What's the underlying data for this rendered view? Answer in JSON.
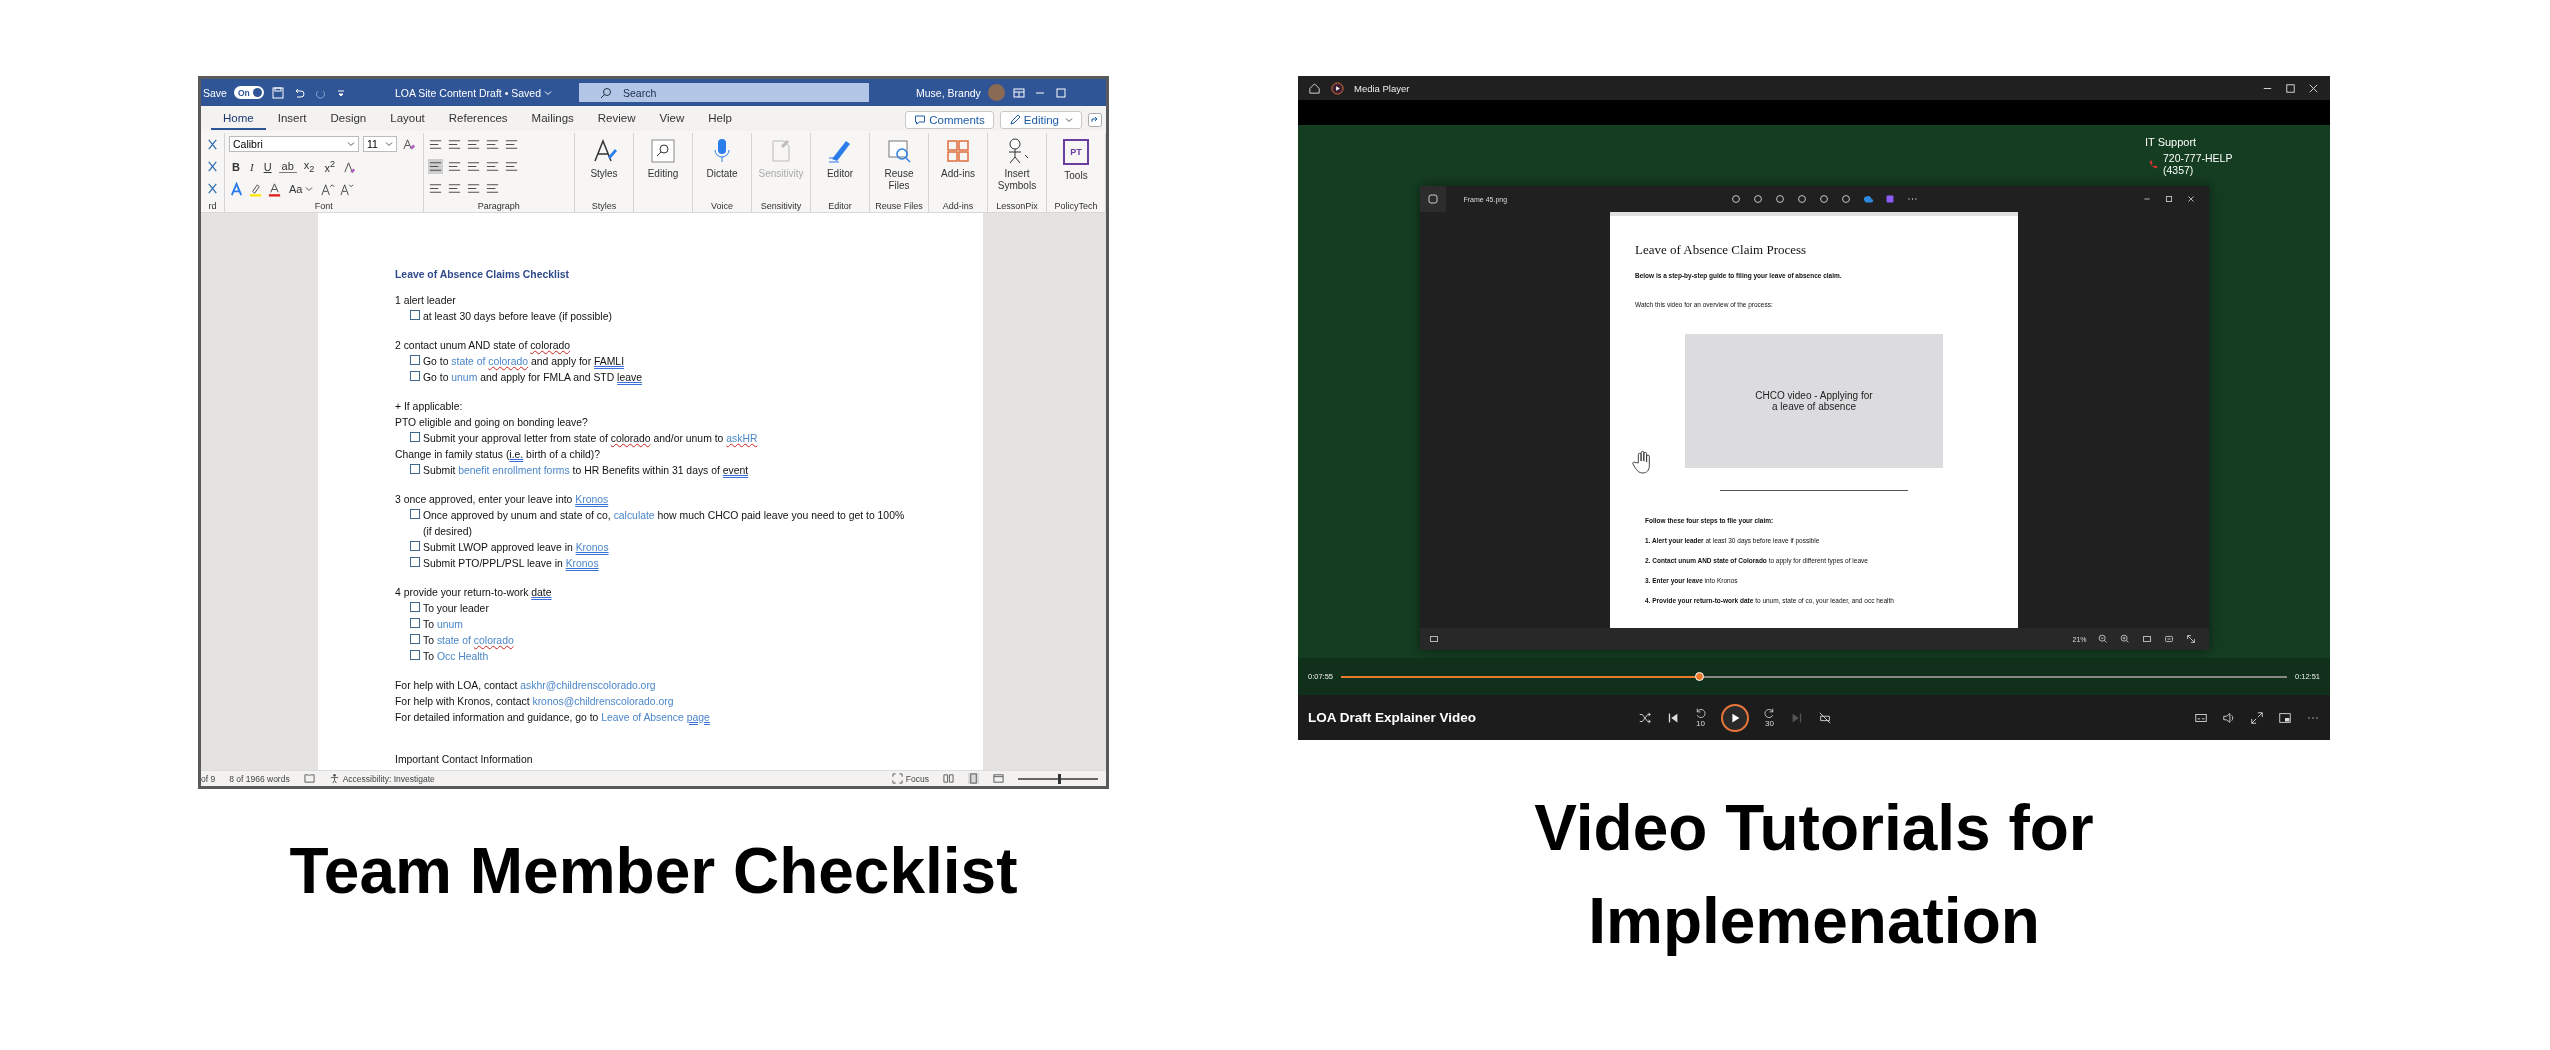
{
  "word": {
    "title_bar": {
      "save_label": "Save",
      "autosave": {
        "label": "On",
        "on": true
      },
      "doc_title": "LOA Site Content Draft • Saved",
      "search_placeholder": "Search",
      "user": "Muse, Brandy"
    },
    "tabs": [
      {
        "label": "Home",
        "selected": true
      },
      {
        "label": "Insert",
        "selected": false
      },
      {
        "label": "Design",
        "selected": false
      },
      {
        "label": "Layout",
        "selected": false
      },
      {
        "label": "References",
        "selected": false
      },
      {
        "label": "Mailings",
        "selected": false
      },
      {
        "label": "Review",
        "selected": false
      },
      {
        "label": "View",
        "selected": false
      },
      {
        "label": "Help",
        "selected": false
      }
    ],
    "comments_button": "Comments",
    "editing_button": "Editing",
    "ribbon": {
      "clipboard_label": "rd",
      "font_label": "Font",
      "font_name": "Calibri",
      "font_size": "11",
      "format_buttons": [
        "B",
        "I",
        "U",
        "ab",
        "x$_{2}$",
        "x$^{2}$"
      ],
      "case_button": "Aa",
      "paragraph_label": "Paragraph",
      "groups": [
        {
          "label": "Styles",
          "buttons": [
            {
              "label": "Styles",
              "disabled": false
            }
          ]
        },
        {
          "buttons": [
            {
              "label": "Editing",
              "disabled": false
            }
          ]
        },
        {
          "label": "Voice",
          "buttons": [
            {
              "label": "Dictate",
              "disabled": false
            }
          ]
        },
        {
          "label": "Sensitivity",
          "buttons": [
            {
              "label": "Sensitivity",
              "disabled": true
            }
          ]
        },
        {
          "label": "Editor",
          "buttons": [
            {
              "label": "Editor",
              "disabled": false
            }
          ]
        },
        {
          "label": "Reuse Files",
          "buttons": [
            {
              "label": "Reuse Files",
              "disabled": false
            }
          ]
        },
        {
          "label": "Add-ins",
          "buttons": [
            {
              "label": "Add-ins",
              "disabled": false
            }
          ]
        },
        {
          "label": "LessonPix",
          "buttons": [
            {
              "label": "Insert Symbols",
              "disabled": false
            }
          ]
        },
        {
          "label": "PolicyTech",
          "buttons": [
            {
              "label": "Tools",
              "disabled": false
            }
          ]
        }
      ],
      "tools_badge": "PT"
    },
    "document": [
      {
        "kind": "heading",
        "segments": [
          {
            "text": "Leave of Absence Claims Checklist",
            "link": false
          }
        ]
      },
      {
        "kind": "text",
        "segments": [
          {
            "text": "1 alert leader",
            "link": false
          }
        ]
      },
      {
        "kind": "check",
        "checked": false,
        "segments": [
          {
            "text": "at least 30 days before leave (if possible)",
            "link": false
          }
        ]
      },
      {
        "kind": "blank"
      },
      {
        "kind": "text",
        "segments": [
          {
            "text": "2 contact unum AND state of ",
            "link": false
          },
          {
            "text": "colorado",
            "link": false,
            "spelling": true
          }
        ]
      },
      {
        "kind": "check",
        "checked": false,
        "segments": [
          {
            "text": "Go to ",
            "link": false
          },
          {
            "link": true,
            "parts": [
              {
                "text": "state of "
              },
              {
                "text": "colorado",
                "spelling": true
              }
            ]
          },
          {
            "text": " and apply for ",
            "link": false
          },
          {
            "text": "FAMLI",
            "link": false,
            "grammar": true
          }
        ]
      },
      {
        "kind": "check",
        "checked": false,
        "segments": [
          {
            "text": "Go to ",
            "link": false
          },
          {
            "text": "unum",
            "link": true
          },
          {
            "text": " and apply for FMLA and STD ",
            "link": false
          },
          {
            "text": "leave",
            "link": false,
            "grammar": true
          }
        ]
      },
      {
        "kind": "blank"
      },
      {
        "kind": "text",
        "segments": [
          {
            "text": "+ If applicable:",
            "link": false
          }
        ]
      },
      {
        "kind": "text",
        "segments": [
          {
            "text": "PTO eligible and going on bonding leave?",
            "link": false
          }
        ]
      },
      {
        "kind": "check",
        "checked": false,
        "segments": [
          {
            "text": "Submit your approval letter from state of ",
            "link": false
          },
          {
            "text": "colorado",
            "link": false,
            "spelling": true
          },
          {
            "text": " and/or unum to ",
            "link": false
          },
          {
            "text": "askHR",
            "link": true,
            "spelling": true
          }
        ]
      },
      {
        "kind": "text",
        "segments": [
          {
            "text": "Change in family status (",
            "link": false
          },
          {
            "text": "i.e.",
            "link": false,
            "grammar": true
          },
          {
            "text": " birth of a child)?",
            "link": false
          }
        ]
      },
      {
        "kind": "check",
        "checked": false,
        "segments": [
          {
            "text": "Submit ",
            "link": false
          },
          {
            "text": "benefit enrollment forms",
            "link": true
          },
          {
            "text": " to HR Benefits within 31 days of ",
            "link": false
          },
          {
            "text": "event",
            "link": false,
            "grammar": true
          }
        ]
      },
      {
        "kind": "blank"
      },
      {
        "kind": "text",
        "segments": [
          {
            "text": "3 once approved, enter your leave into ",
            "link": false
          },
          {
            "text": "Kronos",
            "link": true,
            "grammar": true
          }
        ]
      },
      {
        "kind": "check",
        "checked": false,
        "segments": [
          {
            "text": "Once approved by unum and state of co, ",
            "link": false
          },
          {
            "text": "calculate",
            "link": true
          },
          {
            "text": " how much CHCO paid leave you need to get to 100% (if desired)",
            "link": false
          }
        ]
      },
      {
        "kind": "check",
        "checked": false,
        "segments": [
          {
            "text": "Submit LWOP approved leave in ",
            "link": false
          },
          {
            "text": "Kronos",
            "link": true,
            "grammar": true
          }
        ]
      },
      {
        "kind": "check",
        "checked": false,
        "segments": [
          {
            "text": "Submit PTO/PPL/PSL leave in ",
            "link": false
          },
          {
            "text": "Kronos",
            "link": true,
            "grammar": true
          }
        ]
      },
      {
        "kind": "blank"
      },
      {
        "kind": "text",
        "segments": [
          {
            "text": "4 provide your return-to-work ",
            "link": false
          },
          {
            "text": "date",
            "link": false,
            "grammar": true
          }
        ]
      },
      {
        "kind": "check",
        "checked": false,
        "segments": [
          {
            "text": "To your leader",
            "link": false
          }
        ]
      },
      {
        "kind": "check",
        "checked": false,
        "segments": [
          {
            "text": "To ",
            "link": false
          },
          {
            "text": "unum",
            "link": true
          }
        ]
      },
      {
        "kind": "check",
        "checked": false,
        "segments": [
          {
            "text": "To ",
            "link": false
          },
          {
            "link": true,
            "parts": [
              {
                "text": "state of "
              },
              {
                "text": "colorado",
                "spelling": true
              }
            ]
          }
        ]
      },
      {
        "kind": "check",
        "checked": false,
        "segments": [
          {
            "text": "To ",
            "link": false
          },
          {
            "text": "Occ Health",
            "link": true
          }
        ]
      },
      {
        "kind": "blank"
      },
      {
        "kind": "text",
        "segments": [
          {
            "text": "For help with LOA, contact ",
            "link": false
          },
          {
            "text": "askhr@childrenscolorado.org",
            "link": true
          }
        ]
      },
      {
        "kind": "text",
        "segments": [
          {
            "text": "For help with Kronos, contact ",
            "link": false
          },
          {
            "text": "kronos@childrenscolorado.org",
            "link": true
          }
        ]
      },
      {
        "kind": "text",
        "segments": [
          {
            "text": "For detailed information and guidance, go to ",
            "link": false
          },
          {
            "link": true,
            "parts": [
              {
                "text": "Leave of Absence "
              },
              {
                "text": "page",
                "grammar": true
              }
            ]
          }
        ]
      },
      {
        "kind": "blank"
      },
      {
        "kind": "blank"
      },
      {
        "kind": "text",
        "segments": [
          {
            "text": "Important Contact Information",
            "link": false
          }
        ]
      }
    ],
    "status_bar": {
      "page": "of 9",
      "words": "8 of 1966 words",
      "accessibility": "Accessibility: Investigate",
      "focus": "Focus",
      "zoom": {
        "level": 0.5
      }
    }
  },
  "media": {
    "app_title": "Media Player",
    "it_support": {
      "title": "IT Support",
      "phone": "720-777-HELP (4357)"
    },
    "viewer": {
      "file_name": "Frame 45.png",
      "zoom": "21%",
      "page": {
        "title": "Leave of Absence Claim Process",
        "intro": "Below is a step-by-step guide to filing your leave of absence claim.",
        "watch": "Watch this video for an overview of the process:",
        "video_label": "CHCO video - Applying for a leave of absence",
        "steps_heading": "Follow these four steps to file your claim:",
        "steps": [
          "**1. Alert your leader** at least 30 days before leave if possible",
          "**2. Contact unum AND state of Colorado** to apply for different types of leave",
          "**3. Enter your leave** into Kronos",
          "**4. Provide your return-to-work date** to unum, state of co, your leader, and occ health"
        ]
      }
    },
    "playback": {
      "elapsed": "0:07:55",
      "level": 0.38,
      "duration": "0:12:51",
      "video_title": "LOA Draft Explainer Video",
      "skip_back": "10",
      "skip_forward": "30",
      "next_disabled": true
    }
  },
  "captions": {
    "left": [
      "Team Member Checklist"
    ],
    "right": [
      "Video Tutorials for",
      "Implemenation"
    ]
  }
}
